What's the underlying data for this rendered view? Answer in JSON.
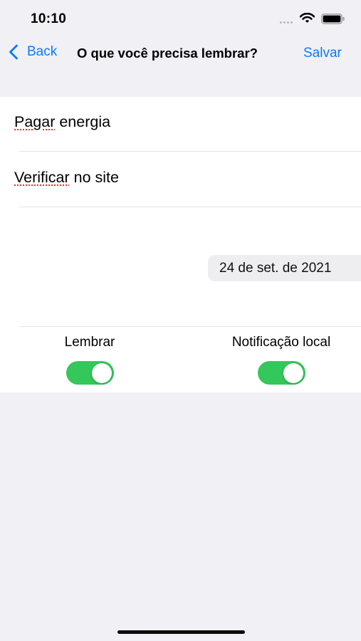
{
  "status_bar": {
    "time": "10:10",
    "icons": [
      "signal-dots-icon",
      "wifi-icon",
      "battery-icon"
    ]
  },
  "nav": {
    "back_label": "Back",
    "title": "O que você precisa lembrar?",
    "save_label": "Salvar",
    "accent_color": "#0a7aff"
  },
  "form": {
    "title_field": {
      "pre": "Pagar",
      "post": " energia"
    },
    "note_field": {
      "pre": "Verificar",
      "post": " no site"
    },
    "date": "24 de set. de 2021"
  },
  "toggles": [
    {
      "label": "Lembrar",
      "on": true
    },
    {
      "label": "Notificação local",
      "on": true
    }
  ],
  "colors": {
    "switch_on": "#34c759",
    "background": "#f0f0f5"
  }
}
